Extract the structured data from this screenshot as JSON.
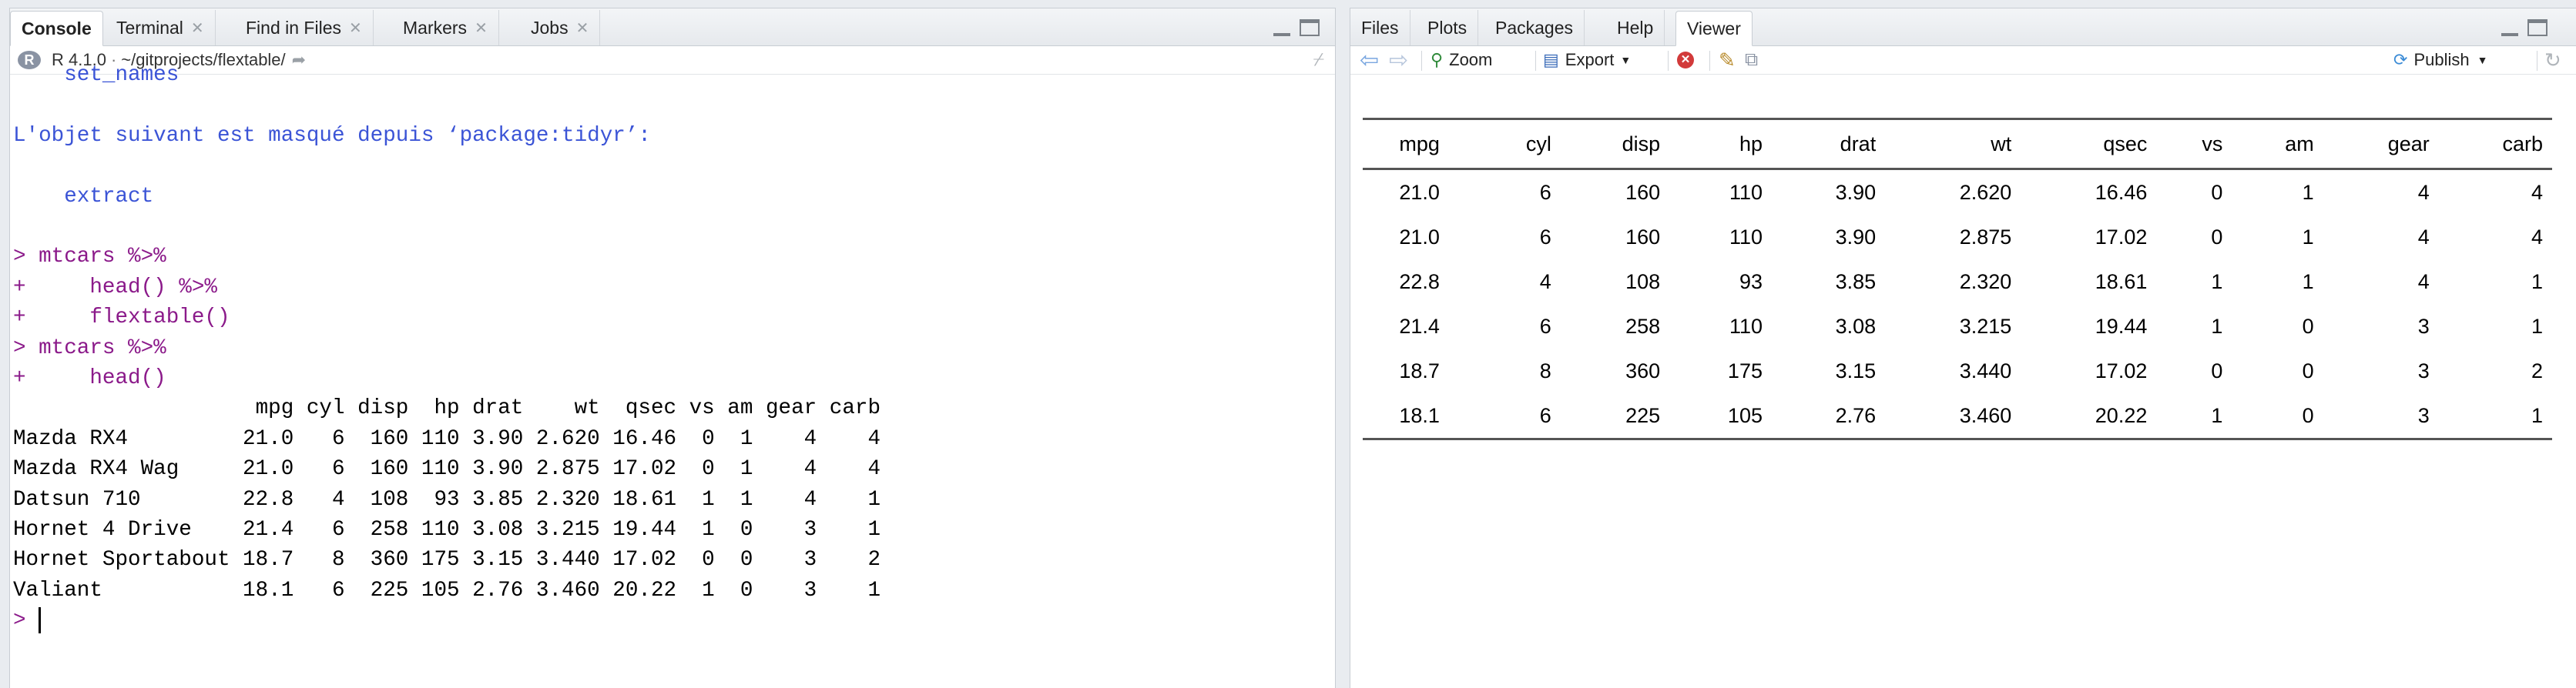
{
  "left_pane": {
    "tabs": [
      "Console",
      "Terminal",
      "Find in Files",
      "Markers",
      "Jobs"
    ],
    "r_version": "R 4.1.0",
    "path": "~/gitprojects/flextable/",
    "lines": [
      {
        "text": "    set_names",
        "style": "blue"
      },
      {
        "text": "",
        "style": "plain"
      },
      {
        "text": "L'objet suivant est masqué depuis ‘package:tidyr’:",
        "style": "blue"
      },
      {
        "text": "",
        "style": "plain"
      },
      {
        "text": "    extract",
        "style": "blue"
      },
      {
        "text": "",
        "style": "plain"
      },
      {
        "text": "> mtcars %>%",
        "style": "prompt"
      },
      {
        "text": "+     head() %>%",
        "style": "prompt"
      },
      {
        "text": "+     flextable()",
        "style": "prompt"
      },
      {
        "text": "> mtcars %>%",
        "style": "prompt"
      },
      {
        "text": "+     head()",
        "style": "prompt"
      },
      {
        "text": "                   mpg cyl disp  hp drat    wt  qsec vs am gear carb",
        "style": "plain"
      },
      {
        "text": "Mazda RX4         21.0   6  160 110 3.90 2.620 16.46  0  1    4    4",
        "style": "plain"
      },
      {
        "text": "Mazda RX4 Wag     21.0   6  160 110 3.90 2.875 17.02  0  1    4    4",
        "style": "plain"
      },
      {
        "text": "Datsun 710        22.8   4  108  93 3.85 2.320 18.61  1  1    4    1",
        "style": "plain"
      },
      {
        "text": "Hornet 4 Drive    21.4   6  258 110 3.08 3.215 19.44  1  0    3    1",
        "style": "plain"
      },
      {
        "text": "Hornet Sportabout 18.7   8  360 175 3.15 3.440 17.02  0  0    3    2",
        "style": "plain"
      },
      {
        "text": "Valiant           18.1   6  225 105 2.76 3.460 20.22  1  0    3    1",
        "style": "plain"
      }
    ],
    "prompt_symbol": ">"
  },
  "right_pane": {
    "tabs": [
      "Files",
      "Plots",
      "Packages",
      "Help",
      "Viewer"
    ],
    "toolbar": {
      "zoom": "Zoom",
      "export": "Export",
      "publish": "Publish"
    },
    "table": {
      "headers": [
        "mpg",
        "cyl",
        "disp",
        "hp",
        "drat",
        "wt",
        "qsec",
        "vs",
        "am",
        "gear",
        "carb"
      ],
      "rows": [
        [
          "21.0",
          "6",
          "160",
          "110",
          "3.90",
          "2.620",
          "16.46",
          "0",
          "1",
          "4",
          "4"
        ],
        [
          "21.0",
          "6",
          "160",
          "110",
          "3.90",
          "2.875",
          "17.02",
          "0",
          "1",
          "4",
          "4"
        ],
        [
          "22.8",
          "4",
          "108",
          "93",
          "3.85",
          "2.320",
          "18.61",
          "1",
          "1",
          "4",
          "1"
        ],
        [
          "21.4",
          "6",
          "258",
          "110",
          "3.08",
          "3.215",
          "19.44",
          "1",
          "0",
          "3",
          "1"
        ],
        [
          "18.7",
          "8",
          "360",
          "175",
          "3.15",
          "3.440",
          "17.02",
          "0",
          "0",
          "3",
          "2"
        ],
        [
          "18.1",
          "6",
          "225",
          "105",
          "2.76",
          "3.460",
          "20.22",
          "1",
          "0",
          "3",
          "1"
        ]
      ]
    }
  },
  "colors": {
    "console_text_blue": "#3b54d6",
    "prompt_purple": "#8b1a8a"
  }
}
